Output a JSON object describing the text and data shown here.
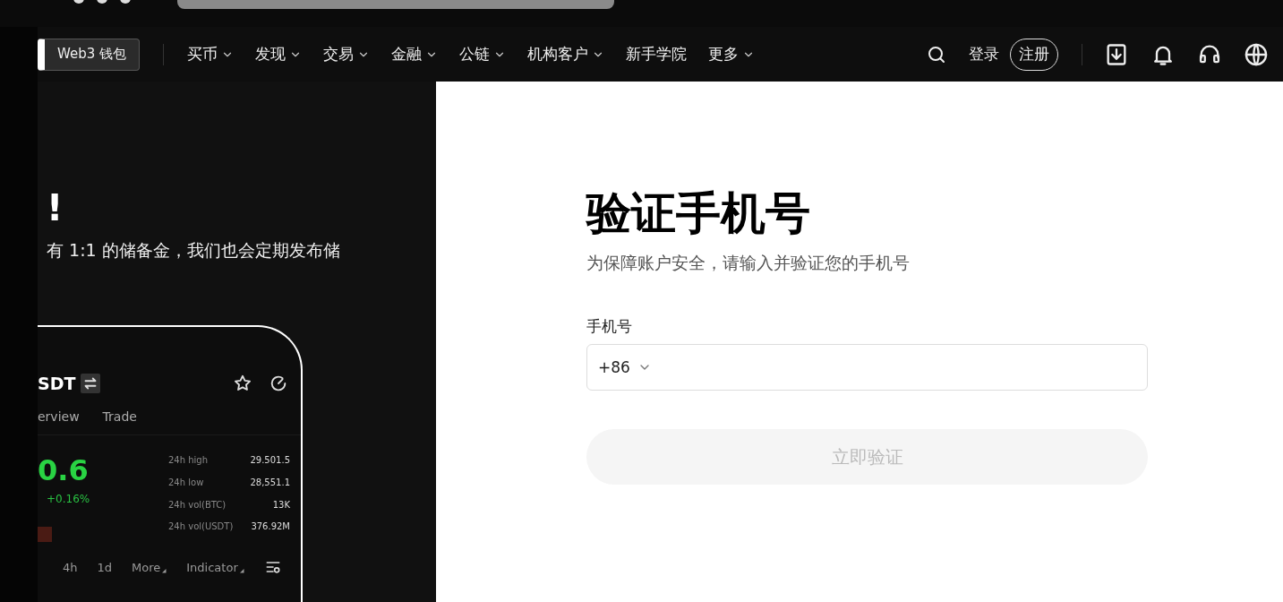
{
  "nav": {
    "wallet_button": "Web3 钱包",
    "menu": [
      {
        "label": "买币",
        "dropdown": true
      },
      {
        "label": "发现",
        "dropdown": true
      },
      {
        "label": "交易",
        "dropdown": true
      },
      {
        "label": "金融",
        "dropdown": true
      },
      {
        "label": "公链",
        "dropdown": true
      },
      {
        "label": "机构客户",
        "dropdown": true
      },
      {
        "label": "新手学院",
        "dropdown": false
      },
      {
        "label": "更多",
        "dropdown": true
      }
    ],
    "login": "登录",
    "register": "注册"
  },
  "hero": {
    "heading": "!",
    "description": "有 1:1 的储备金，我们也会定期发布储"
  },
  "phone": {
    "pair": "SDT",
    "tabs": [
      "erview",
      "Trade"
    ],
    "price": "0.6",
    "change": "+0.16%",
    "stats": [
      {
        "label": "24h high",
        "value": "29.501.5"
      },
      {
        "label": "24h low",
        "value": "28,551.1"
      },
      {
        "label": "24h vol(BTC)",
        "value": "13K"
      },
      {
        "label": "24h vol(USDT)",
        "value": "376.92M"
      }
    ],
    "intervals": [
      {
        "label": "4h",
        "kind": "plain"
      },
      {
        "label": "1d",
        "kind": "plain"
      },
      {
        "label": "More",
        "kind": "dropdown"
      },
      {
        "label": "Indicator",
        "kind": "dropdown"
      }
    ]
  },
  "form": {
    "title": "验证手机号",
    "subtitle": "为保障账户安全，请输入并验证您的手机号",
    "phone_label": "手机号",
    "country_code": "+86",
    "submit": {
      "label": "立即验证",
      "disabled": true
    }
  }
}
